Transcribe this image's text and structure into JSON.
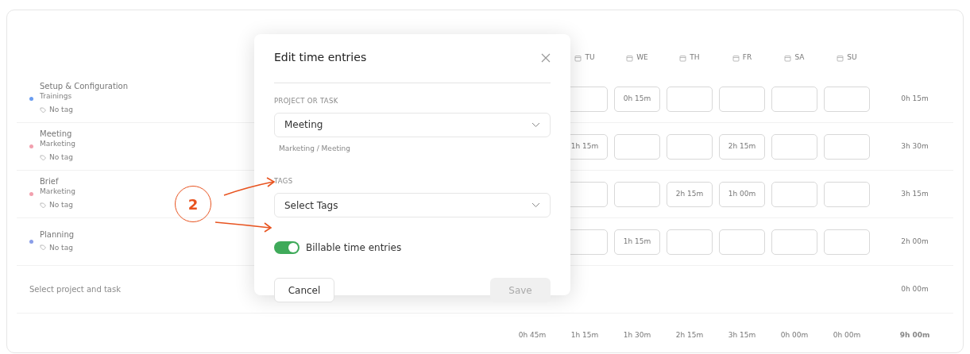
{
  "timesheet": {
    "days": [
      {
        "label": "TU"
      },
      {
        "label": "WE"
      },
      {
        "label": "TH"
      },
      {
        "label": "FR"
      },
      {
        "label": "SA"
      },
      {
        "label": "SU"
      }
    ],
    "rows": [
      {
        "kind": "task",
        "name": "Setup & Configuration",
        "project": "Trainings",
        "color": "#6a9cf0",
        "tag": "No tag",
        "cells": [
          null,
          "0h 15m",
          null,
          null,
          null,
          null
        ],
        "total": "0h 15m"
      },
      {
        "kind": "task",
        "name": "Meeting",
        "project": "Marketing",
        "color": "#f2a0ae",
        "tag": "No tag",
        "cells": [
          "1h 15m",
          null,
          null,
          "2h 15m",
          null,
          null
        ],
        "total": "3h 30m"
      },
      {
        "kind": "task",
        "name": "Brief",
        "project": "Marketing",
        "color": "#f2a0ae",
        "tag": "No tag",
        "cells": [
          null,
          null,
          "2h 15m",
          "1h 00m",
          null,
          null
        ],
        "total": "3h 15m"
      },
      {
        "kind": "task",
        "name": "Planning",
        "color": "#8a9ee8",
        "tag": "No tag",
        "cells": [
          null,
          "1h 15m",
          null,
          null,
          null,
          null
        ],
        "total": "2h 00m"
      },
      {
        "kind": "new",
        "name": "Select project and task",
        "total": "0h 00m"
      }
    ],
    "day_totals": [
      "0h 45m",
      "1h 15m",
      "1h 30m",
      "2h 15m",
      "3h 15m",
      "0h 00m",
      "0h 00m"
    ],
    "grand_total": "9h 00m"
  },
  "modal": {
    "title": "Edit time entries",
    "project_field": {
      "label": "PROJECT OR TASK",
      "value": "Meeting",
      "hint": "Marketing / Meeting"
    },
    "tags_field": {
      "label": "TAGS",
      "placeholder": "Select Tags"
    },
    "billable": {
      "label": "Billable time entries",
      "on": true
    },
    "buttons": [
      {
        "label": "Cancel",
        "kind": "secondary",
        "disabled": false
      },
      {
        "label": "Save",
        "kind": "primary",
        "disabled": true
      }
    ]
  },
  "annotation": {
    "label": "2"
  }
}
